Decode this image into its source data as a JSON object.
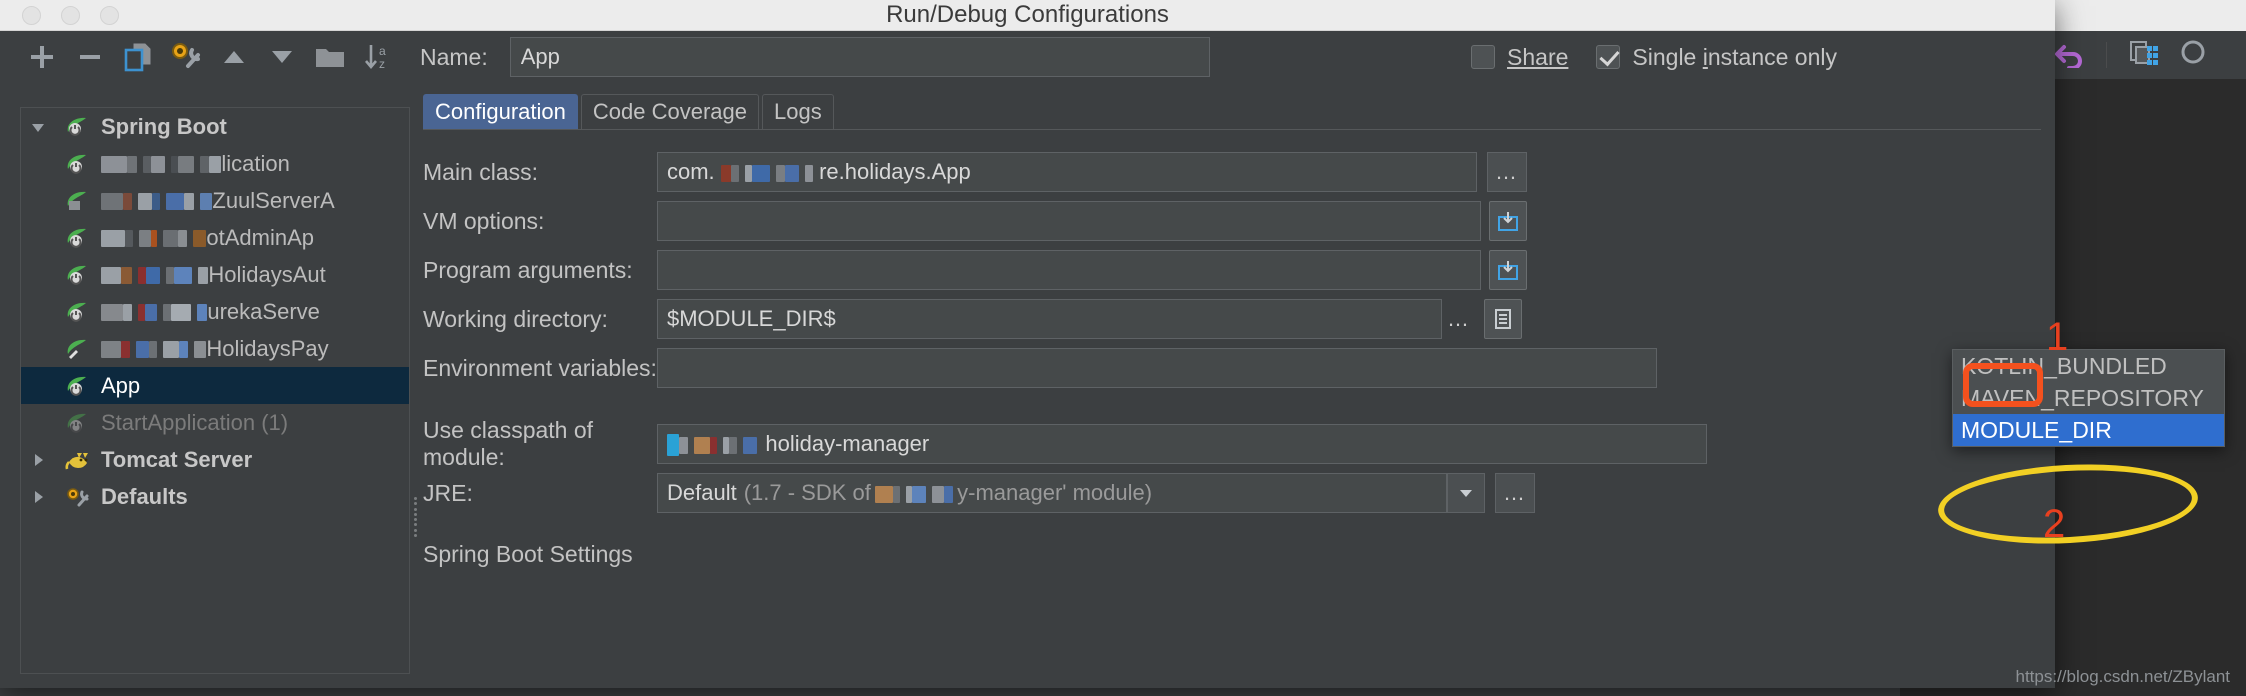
{
  "window": {
    "title": "Run/Debug Configurations",
    "traffic_lights": [
      "close",
      "minimize",
      "zoom"
    ]
  },
  "left_toolbar": {
    "buttons": [
      {
        "name": "add-button",
        "glyph": "+"
      },
      {
        "name": "remove-button",
        "glyph": "−"
      },
      {
        "name": "copy-configuration-button",
        "glyph": "copy"
      },
      {
        "name": "edit-templates-button",
        "glyph": "wrench"
      },
      {
        "name": "move-up-button",
        "glyph": "▲"
      },
      {
        "name": "move-down-button",
        "glyph": "▼"
      },
      {
        "name": "folder-button",
        "glyph": "folder"
      },
      {
        "name": "sort-alphabetically-button",
        "glyph": "sort-az"
      }
    ]
  },
  "tree": {
    "nodes": [
      {
        "label": "Spring Boot",
        "type": "group",
        "expanded": true,
        "icon": "spring-leaf-icon",
        "state": "normal",
        "redacted": false
      },
      {
        "label": "lication",
        "type": "item",
        "icon": "spring-run-icon",
        "state": "normal",
        "redacted": true
      },
      {
        "label": "ZuulServerA",
        "type": "item",
        "icon": "spring-run-icon",
        "state": "normal",
        "redacted": true
      },
      {
        "label": "otAdminAp",
        "type": "item",
        "icon": "spring-run-icon",
        "state": "normal",
        "redacted": true
      },
      {
        "label": "HolidaysAut",
        "type": "item",
        "icon": "spring-run-icon",
        "state": "normal",
        "redacted": true
      },
      {
        "label": "urekaServe",
        "type": "item",
        "icon": "spring-run-icon",
        "state": "normal",
        "redacted": true
      },
      {
        "label": "HolidaysPay",
        "type": "item",
        "icon": "spring-run-icon",
        "state": "normal",
        "redacted": true
      },
      {
        "label": "App",
        "type": "item",
        "icon": "spring-run-icon",
        "state": "selected",
        "redacted": false
      },
      {
        "label": "StartApplication (1)",
        "type": "item",
        "icon": "spring-run-icon",
        "state": "disabled",
        "redacted": false
      },
      {
        "label": "Tomcat Server",
        "type": "group",
        "expanded": false,
        "icon": "tomcat-cat-icon",
        "state": "normal",
        "redacted": false
      },
      {
        "label": "Defaults",
        "type": "group",
        "expanded": false,
        "icon": "defaults-gear-icon",
        "state": "normal",
        "redacted": false
      }
    ]
  },
  "header": {
    "name_label": "Name:",
    "name_value": "App",
    "share_label": "Share",
    "share_checked": false,
    "single_instance_label_pre": "Single ",
    "single_instance_label_mid": "i",
    "single_instance_label_post": "nstance only",
    "single_instance_checked": true
  },
  "tabs": [
    {
      "label": "Configuration",
      "active": true
    },
    {
      "label": "Code Coverage",
      "active": false
    },
    {
      "label": "Logs",
      "active": false
    }
  ],
  "form": {
    "main_class": {
      "label": "Main class:",
      "value_prefix": "com.",
      "value_suffix": "re.holidays.App",
      "browse": "…"
    },
    "vm_options": {
      "label": "VM options:",
      "value": "",
      "expand_icon": "expand-editor-icon"
    },
    "program_arguments": {
      "label": "Program arguments:",
      "value": "",
      "expand_icon": "expand-editor-icon"
    },
    "working_directory": {
      "label": "Working directory:",
      "value": "$MODULE_DIR$",
      "browse": "…",
      "macro_icon": "insert-macro-icon"
    },
    "environment_variables": {
      "label": "Environment variables:",
      "value": ""
    },
    "use_classpath": {
      "label": "Use classpath of module:",
      "value": "holiday-manager"
    },
    "jre": {
      "label": "JRE:",
      "value_strong": "Default",
      "value_dim_prefix": "(1.7 - SDK of ",
      "value_dim_suffix": "y-manager' module)",
      "browse": "…"
    },
    "spring_boot_settings": "Spring Boot Settings"
  },
  "dropdown": {
    "items": [
      {
        "label": "KOTLIN_BUNDLED",
        "selected": false
      },
      {
        "label": "MAVEN_REPOSITORY",
        "selected": false
      },
      {
        "label": "MODULE_DIR",
        "selected": true
      }
    ]
  },
  "annotations": [
    {
      "name": "annotation-1",
      "shape": "rounded-rect",
      "color": "#f4511e",
      "label": "1"
    },
    {
      "name": "annotation-2",
      "shape": "ellipse",
      "color": "#f2d024",
      "label": "2"
    }
  ],
  "background_ide": {
    "toolbar_icons": [
      "run-with-coverage-icon",
      "revert-icon",
      "copy-paste-icon",
      "search-icon"
    ]
  },
  "watermark": "https://blog.csdn.net/ZBylant",
  "colors": {
    "dialog_bg": "#3c3f41",
    "field_bg": "#45494a",
    "tab_active": "#4a6593",
    "tree_selected": "#0d293e",
    "dropdown_selected": "#2f6ecf",
    "annotation_red": "#f4511e",
    "annotation_yellow": "#f2d024"
  }
}
